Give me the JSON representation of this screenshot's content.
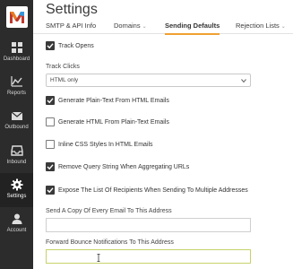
{
  "app": {
    "title": "Settings"
  },
  "sidebar": {
    "items": [
      {
        "label": "Dashboard",
        "icon": "dashboard-icon"
      },
      {
        "label": "Reports",
        "icon": "reports-icon"
      },
      {
        "label": "Outbound",
        "icon": "outbound-icon"
      },
      {
        "label": "Inbound",
        "icon": "inbound-icon"
      },
      {
        "label": "Settings",
        "icon": "gear-icon",
        "active": true
      },
      {
        "label": "Account",
        "icon": "account-icon"
      }
    ]
  },
  "tabs": [
    {
      "label": "SMTP & API Info",
      "dropdown": false
    },
    {
      "label": "Domains",
      "dropdown": true
    },
    {
      "label": "Sending Defaults",
      "dropdown": false,
      "active": true
    },
    {
      "label": "Rejection Lists",
      "dropdown": true
    }
  ],
  "form": {
    "track_opens": {
      "label": "Track Opens",
      "checked": true
    },
    "track_clicks": {
      "label": "Track Clicks",
      "value": "HTML only"
    },
    "plain_text": {
      "label": "Generate Plain-Text From HTML Emails",
      "checked": true
    },
    "html_from_plain": {
      "label": "Generate HTML From Plain-Text Emails",
      "checked": false
    },
    "inline_css": {
      "label": "Inline CSS Styles In HTML Emails",
      "checked": false
    },
    "remove_query": {
      "label": "Remove Query String When Aggregating URLs",
      "checked": true
    },
    "expose_recipients": {
      "label": "Expose The List Of Recipients When Sending To Multiple Addresses",
      "checked": true
    },
    "bcc_address": {
      "label": "Send A Copy Of Every Email To This Address",
      "value": ""
    },
    "bounce_forward": {
      "label": "Forward Bounce Notifications To This Address",
      "value": ""
    }
  },
  "colors": {
    "sidebar_bg": "#2c2c2c",
    "active_tab_underline": "#f0a030",
    "checkbox_checked": "#3a3a3a",
    "focused_input_border": "#c7d26a"
  }
}
